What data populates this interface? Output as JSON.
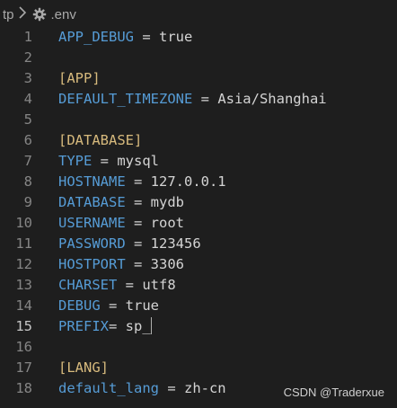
{
  "breadcrumb": {
    "folder": "tp",
    "file": ".env"
  },
  "editor": {
    "active_line": 15,
    "lines": [
      {
        "n": "1",
        "key": "APP_DEBUG",
        "op": " = ",
        "value": "true"
      },
      {
        "n": "2"
      },
      {
        "n": "3",
        "section": "[APP]"
      },
      {
        "n": "4",
        "key": "DEFAULT_TIMEZONE",
        "op": " = ",
        "value": "Asia/Shanghai"
      },
      {
        "n": "5"
      },
      {
        "n": "6",
        "section": "[DATABASE]"
      },
      {
        "n": "7",
        "key": "TYPE",
        "op": " = ",
        "value": "mysql"
      },
      {
        "n": "8",
        "key": "HOSTNAME",
        "op": " = ",
        "value": "127.0.0.1"
      },
      {
        "n": "9",
        "key": "DATABASE",
        "op": " = ",
        "value": "mydb"
      },
      {
        "n": "10",
        "key": "USERNAME",
        "op": " = ",
        "value": "root"
      },
      {
        "n": "11",
        "key": "PASSWORD",
        "op": " = ",
        "value": "123456"
      },
      {
        "n": "12",
        "key": "HOSTPORT",
        "op": " = ",
        "value": "3306"
      },
      {
        "n": "13",
        "key": "CHARSET",
        "op": " = ",
        "value": "utf8"
      },
      {
        "n": "14",
        "key": "DEBUG",
        "op": " = ",
        "value": "true"
      },
      {
        "n": "15",
        "key": "PREFIX",
        "op": "= ",
        "value": "sp_"
      },
      {
        "n": "16"
      },
      {
        "n": "17",
        "section": "[LANG]"
      },
      {
        "n": "18",
        "key": "default_lang",
        "op": " = ",
        "value": "zh-cn"
      }
    ]
  },
  "watermark": "CSDN @Traderxue",
  "colors": {
    "background": "#1e1e1e",
    "key": "#569cd6",
    "section": "#d7ba7d",
    "text": "#d4d4d4",
    "line_number": "#858585"
  },
  "icons": {
    "file_type": "gear-icon",
    "separator": "chevron-right-icon"
  }
}
